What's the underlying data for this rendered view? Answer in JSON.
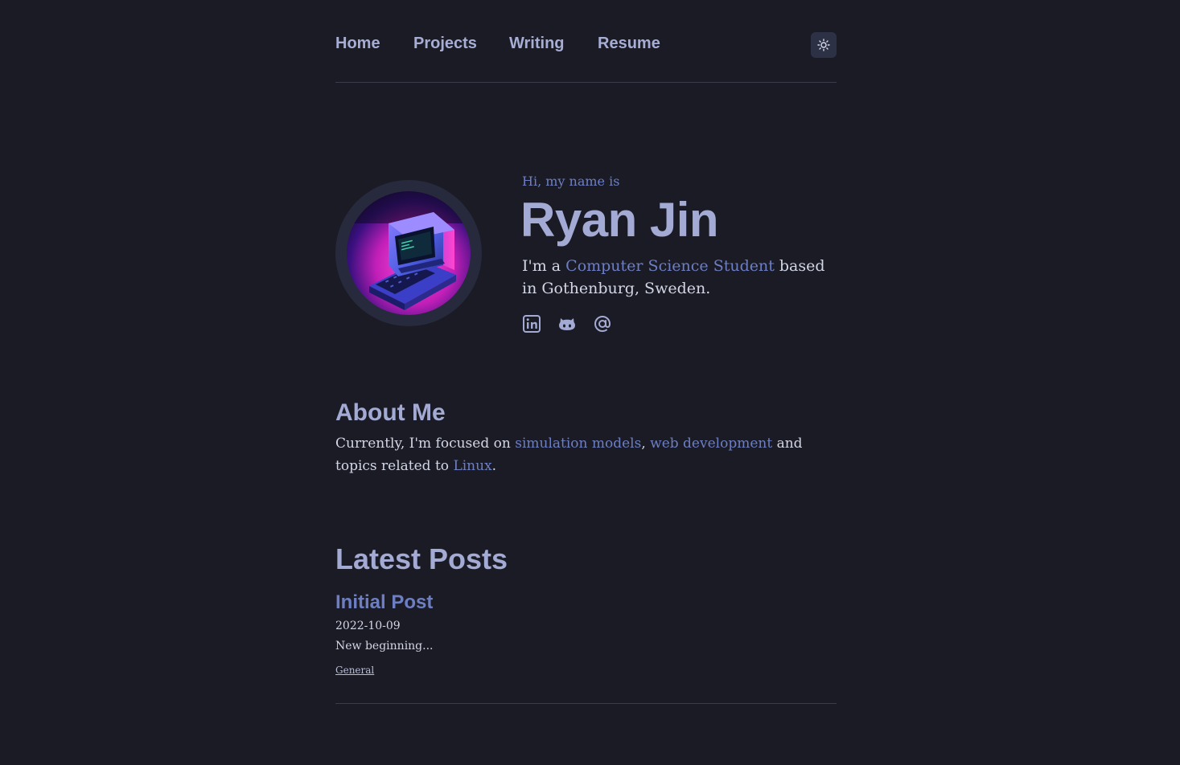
{
  "nav": {
    "items": [
      {
        "label": "Home"
      },
      {
        "label": "Projects"
      },
      {
        "label": "Writing"
      },
      {
        "label": "Resume"
      }
    ],
    "theme_toggle_icon": "sun-icon"
  },
  "hero": {
    "greeting": "Hi, my name is",
    "name": "Ryan Jin",
    "intro_prefix": "I'm a ",
    "intro_highlight": "Computer Science Student",
    "intro_suffix": " based in Gothenburg, Sweden.",
    "avatar": "retro-computer-avatar",
    "socials": [
      "linkedin-icon",
      "github-icon",
      "email-at-icon"
    ]
  },
  "about": {
    "title": "About Me",
    "text_1": "Currently, I'm focused on ",
    "link_1": "simulation models",
    "text_2": ", ",
    "link_2": "web development",
    "text_3": " and topics related to ",
    "link_3": "Linux",
    "text_4": "."
  },
  "posts": {
    "title": "Latest Posts",
    "items": [
      {
        "title": "Initial Post",
        "date": "2022-10-09",
        "summary": "New beginning...",
        "tag": "General"
      }
    ]
  },
  "colors": {
    "background": "#1b1b26",
    "accent": "#6d7fc2",
    "heading": "#a3aad3",
    "text": "#d3d6e4"
  }
}
